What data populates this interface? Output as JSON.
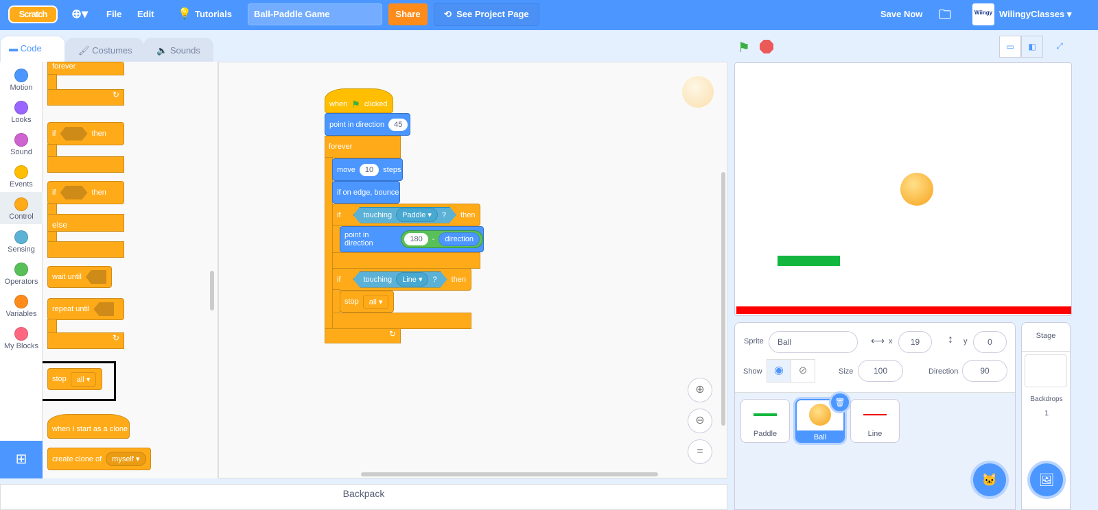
{
  "topbar": {
    "logo": "Scratch",
    "file": "File",
    "edit": "Edit",
    "tutorials": "Tutorials",
    "project_title": "Ball-Paddle Game",
    "share": "Share",
    "see_project_page": "See Project Page",
    "save_now": "Save Now",
    "username": "WilingyClasses",
    "avatar_text": "Wiingy"
  },
  "tabs": [
    {
      "label": "Code"
    },
    {
      "label": "Costumes"
    },
    {
      "label": "Sounds"
    }
  ],
  "categories": [
    {
      "label": "Motion",
      "color": "#4c97ff"
    },
    {
      "label": "Looks",
      "color": "#9966ff"
    },
    {
      "label": "Sound",
      "color": "#cf63cf"
    },
    {
      "label": "Events",
      "color": "#ffbf00"
    },
    {
      "label": "Control",
      "color": "#ffab19"
    },
    {
      "label": "Sensing",
      "color": "#5cb1d6"
    },
    {
      "label": "Operators",
      "color": "#59c059"
    },
    {
      "label": "Variables",
      "color": "#ff8c1a"
    },
    {
      "label": "My Blocks",
      "color": "#ff6680"
    }
  ],
  "palette": {
    "forever": "forever",
    "if": "if",
    "then": "then",
    "else": "else",
    "wait_until": "wait until",
    "repeat_until": "repeat until",
    "stop": "stop",
    "stop_opt": "all",
    "clone_start": "when I start as a clone",
    "create_clone": "create clone of",
    "create_clone_opt": "myself"
  },
  "script": {
    "when": "when",
    "clicked": "clicked",
    "point_dir": "point in direction",
    "dir_val": "45",
    "forever": "forever",
    "move": "move",
    "steps_val": "10",
    "steps": "steps",
    "bounce": "if on edge, bounce",
    "if": "if",
    "touching": "touching",
    "paddle": "Paddle",
    "q": "?",
    "then": "then",
    "point_dir2": "point in direction",
    "op_val": "180",
    "minus": "-",
    "direction": "direction",
    "line": "Line",
    "stop": "stop",
    "stop_opt": "all"
  },
  "backpack": "Backpack",
  "sprite_info": {
    "sprite_label": "Sprite",
    "sprite_name": "Ball",
    "x_label": "x",
    "x": "19",
    "y_label": "y",
    "y": "0",
    "show_label": "Show",
    "size_label": "Size",
    "size": "100",
    "direction_label": "Direction",
    "direction": "90"
  },
  "sprites": [
    {
      "name": "Paddle"
    },
    {
      "name": "Ball",
      "selected": true
    },
    {
      "name": "Line"
    }
  ],
  "stage_pane": {
    "title": "Stage",
    "backdrops_label": "Backdrops",
    "backdrops_count": "1"
  }
}
